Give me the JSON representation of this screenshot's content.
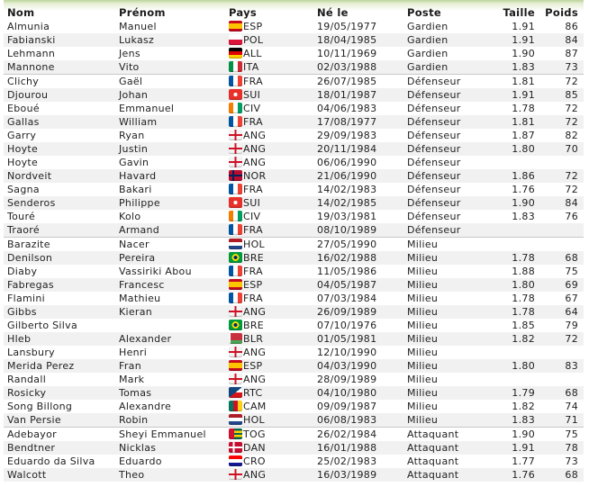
{
  "headers": {
    "nom": "Nom",
    "prenom": "Prénom",
    "pays": "Pays",
    "ne_le": "Né le",
    "poste": "Poste",
    "taille": "Taille",
    "poids": "Poids"
  },
  "flag_styles": {
    "ESP": "linear-gradient(#c60b1e 0 25%, #ffc400 25% 75%, #c60b1e 75%)",
    "POL": "linear-gradient(#ffffff 0 50%, #dc143c 50%)",
    "ALL": "linear-gradient(#000000 0 33%, #dd0000 33% 66%, #ffce00 66%)",
    "ITA": "linear-gradient(90deg, #009246 0 33%, #ffffff 33% 66%, #ce2b37 66%)",
    "FRA": "linear-gradient(90deg, #0055a4 0 33%, #ffffff 33% 66%, #ef4135 66%)",
    "SUI": "radial-gradient(circle, #ffffff 0 22%, transparent 23%), #e8312a",
    "CIV": "linear-gradient(90deg, #f77f00 0 33%, #ffffff 33% 66%, #009e60 66%)",
    "ANG": "linear-gradient(90deg, transparent 0 42%, #ce1124 42% 58%, transparent 58%), linear-gradient(transparent 0 40%, #ce1124 40% 60%, transparent 60%), #f4f4f4",
    "NOR": "linear-gradient(90deg, transparent 0 28%, #00205b 28% 40%, transparent 40%), linear-gradient(transparent 0 42%, #00205b 42% 58%, transparent 58%), #ba0c2f",
    "HOL": "linear-gradient(#ae1c28 0 33%, #ffffff 33% 66%, #21468b 66%)",
    "BRE": "radial-gradient(circle, #002776 0 20%, #ffdf00 21% 40%, #009c3b 41%)",
    "BLR": "linear-gradient(90deg, #ffffff 0 15%, transparent 15%), linear-gradient(#c8313e 0 66%, #4aa657 66%)",
    "RTC": "linear-gradient(to bottom right, #11457e 0 50%, transparent 50%), linear-gradient(#ffffff 0 50%, #d7141a 50%)",
    "CAM": "linear-gradient(90deg, #007a5e 0 33%, #ce1126 33% 66%, #fcd116 66%)",
    "TOG": "linear-gradient(90deg, #d21034 0 40%, transparent 40%), linear-gradient(#006a4e 0 20%, #ffce00 20% 40%, #006a4e 40% 60%, #ffce00 60% 80%, #006a4e 80%)",
    "DAN": "linear-gradient(90deg, transparent 0 30%, #ffffff 30% 42%, transparent 42%), linear-gradient(transparent 0 42%, #ffffff 42% 58%, transparent 58%), #c60c30",
    "CRO": "linear-gradient(#ff0000 0 33%, #ffffff 33% 66%, #171796 66%)"
  },
  "players": [
    {
      "nom": "Almunia",
      "prenom": "Manuel",
      "pays": "ESP",
      "ne_le": "19/05/1977",
      "poste": "Gardien",
      "taille": "1.91",
      "poids": "86",
      "group_start": false
    },
    {
      "nom": "Fabianski",
      "prenom": "Lukasz",
      "pays": "POL",
      "ne_le": "18/04/1985",
      "poste": "Gardien",
      "taille": "1.91",
      "poids": "84",
      "group_start": false
    },
    {
      "nom": "Lehmann",
      "prenom": "Jens",
      "pays": "ALL",
      "ne_le": "10/11/1969",
      "poste": "Gardien",
      "taille": "1.90",
      "poids": "87",
      "group_start": false
    },
    {
      "nom": "Mannone",
      "prenom": "Vito",
      "pays": "ITA",
      "ne_le": "02/03/1988",
      "poste": "Gardien",
      "taille": "1.83",
      "poids": "73",
      "group_start": false
    },
    {
      "nom": "Clichy",
      "prenom": "Gaël",
      "pays": "FRA",
      "ne_le": "26/07/1985",
      "poste": "Défenseur",
      "taille": "1.81",
      "poids": "72",
      "group_start": true
    },
    {
      "nom": "Djourou",
      "prenom": "Johan",
      "pays": "SUI",
      "ne_le": "18/01/1987",
      "poste": "Défenseur",
      "taille": "1.91",
      "poids": "85",
      "group_start": false
    },
    {
      "nom": "Eboué",
      "prenom": "Emmanuel",
      "pays": "CIV",
      "ne_le": "04/06/1983",
      "poste": "Défenseur",
      "taille": "1.78",
      "poids": "72",
      "group_start": false
    },
    {
      "nom": "Gallas",
      "prenom": "William",
      "pays": "FRA",
      "ne_le": "17/08/1977",
      "poste": "Défenseur",
      "taille": "1.81",
      "poids": "72",
      "group_start": false
    },
    {
      "nom": "Garry",
      "prenom": "Ryan",
      "pays": "ANG",
      "ne_le": "29/09/1983",
      "poste": "Défenseur",
      "taille": "1.87",
      "poids": "82",
      "group_start": false
    },
    {
      "nom": "Hoyte",
      "prenom": "Justin",
      "pays": "ANG",
      "ne_le": "20/11/1984",
      "poste": "Défenseur",
      "taille": "1.80",
      "poids": "70",
      "group_start": false
    },
    {
      "nom": "Hoyte",
      "prenom": "Gavin",
      "pays": "ANG",
      "ne_le": "06/06/1990",
      "poste": "Défenseur",
      "taille": "",
      "poids": "",
      "group_start": false
    },
    {
      "nom": "Nordveit",
      "prenom": "Havard",
      "pays": "NOR",
      "ne_le": "21/06/1990",
      "poste": "Défenseur",
      "taille": "1.86",
      "poids": "72",
      "group_start": false
    },
    {
      "nom": "Sagna",
      "prenom": "Bakari",
      "pays": "FRA",
      "ne_le": "14/02/1983",
      "poste": "Défenseur",
      "taille": "1.76",
      "poids": "72",
      "group_start": false
    },
    {
      "nom": "Senderos",
      "prenom": "Philippe",
      "pays": "SUI",
      "ne_le": "14/02/1985",
      "poste": "Défenseur",
      "taille": "1.90",
      "poids": "84",
      "group_start": false
    },
    {
      "nom": "Touré",
      "prenom": "Kolo",
      "pays": "CIV",
      "ne_le": "19/03/1981",
      "poste": "Défenseur",
      "taille": "1.83",
      "poids": "76",
      "group_start": false
    },
    {
      "nom": "Traoré",
      "prenom": "Armand",
      "pays": "FRA",
      "ne_le": "08/10/1989",
      "poste": "Défenseur",
      "taille": "",
      "poids": "",
      "group_start": false
    },
    {
      "nom": "Barazite",
      "prenom": "Nacer",
      "pays": "HOL",
      "ne_le": "27/05/1990",
      "poste": "Milieu",
      "taille": "",
      "poids": "",
      "group_start": true
    },
    {
      "nom": "Denilson",
      "prenom": "Pereira",
      "pays": "BRE",
      "ne_le": "16/02/1988",
      "poste": "Milieu",
      "taille": "1.78",
      "poids": "68",
      "group_start": false
    },
    {
      "nom": "Diaby",
      "prenom": "Vassiriki Abou",
      "pays": "FRA",
      "ne_le": "11/05/1986",
      "poste": "Milieu",
      "taille": "1.88",
      "poids": "75",
      "group_start": false
    },
    {
      "nom": "Fabregas",
      "prenom": "Francesc",
      "pays": "ESP",
      "ne_le": "04/05/1987",
      "poste": "Milieu",
      "taille": "1.80",
      "poids": "69",
      "group_start": false
    },
    {
      "nom": "Flamini",
      "prenom": "Mathieu",
      "pays": "FRA",
      "ne_le": "07/03/1984",
      "poste": "Milieu",
      "taille": "1.78",
      "poids": "67",
      "group_start": false
    },
    {
      "nom": "Gibbs",
      "prenom": "Kieran",
      "pays": "ANG",
      "ne_le": "26/09/1989",
      "poste": "Milieu",
      "taille": "1.78",
      "poids": "64",
      "group_start": false
    },
    {
      "nom": "Gilberto Silva",
      "prenom": "",
      "pays": "BRE",
      "ne_le": "07/10/1976",
      "poste": "Milieu",
      "taille": "1.85",
      "poids": "79",
      "group_start": false
    },
    {
      "nom": "Hleb",
      "prenom": "Alexander",
      "pays": "BLR",
      "ne_le": "01/05/1981",
      "poste": "Milieu",
      "taille": "1.82",
      "poids": "72",
      "group_start": false
    },
    {
      "nom": "Lansbury",
      "prenom": "Henri",
      "pays": "ANG",
      "ne_le": "12/10/1990",
      "poste": "Milieu",
      "taille": "",
      "poids": "",
      "group_start": false
    },
    {
      "nom": "Merida Perez",
      "prenom": "Fran",
      "pays": "ESP",
      "ne_le": "04/03/1990",
      "poste": "Milieu",
      "taille": "1.80",
      "poids": "83",
      "group_start": false
    },
    {
      "nom": "Randall",
      "prenom": "Mark",
      "pays": "ANG",
      "ne_le": "28/09/1989",
      "poste": "Milieu",
      "taille": "",
      "poids": "",
      "group_start": false
    },
    {
      "nom": "Rosicky",
      "prenom": "Tomas",
      "pays": "RTC",
      "ne_le": "04/10/1980",
      "poste": "Milieu",
      "taille": "1.79",
      "poids": "68",
      "group_start": false
    },
    {
      "nom": "Song Billong",
      "prenom": "Alexandre",
      "pays": "CAM",
      "ne_le": "09/09/1987",
      "poste": "Milieu",
      "taille": "1.82",
      "poids": "74",
      "group_start": false
    },
    {
      "nom": "Van Persie",
      "prenom": "Robin",
      "pays": "HOL",
      "ne_le": "06/08/1983",
      "poste": "Milieu",
      "taille": "1.83",
      "poids": "71",
      "group_start": false
    },
    {
      "nom": "Adebayor",
      "prenom": "Sheyi Emmanuel",
      "pays": "TOG",
      "ne_le": "26/02/1984",
      "poste": "Attaquant",
      "taille": "1.90",
      "poids": "75",
      "group_start": true
    },
    {
      "nom": "Bendtner",
      "prenom": "Nicklas",
      "pays": "DAN",
      "ne_le": "16/01/1988",
      "poste": "Attaquant",
      "taille": "1.91",
      "poids": "78",
      "group_start": false
    },
    {
      "nom": "Eduardo da Silva",
      "prenom": "Eduardo",
      "pays": "CRO",
      "ne_le": "25/02/1983",
      "poste": "Attaquant",
      "taille": "1.77",
      "poids": "73",
      "group_start": false
    },
    {
      "nom": "Walcott",
      "prenom": "Theo",
      "pays": "ANG",
      "ne_le": "16/03/1989",
      "poste": "Attaquant",
      "taille": "1.76",
      "poids": "68",
      "group_start": false
    }
  ]
}
